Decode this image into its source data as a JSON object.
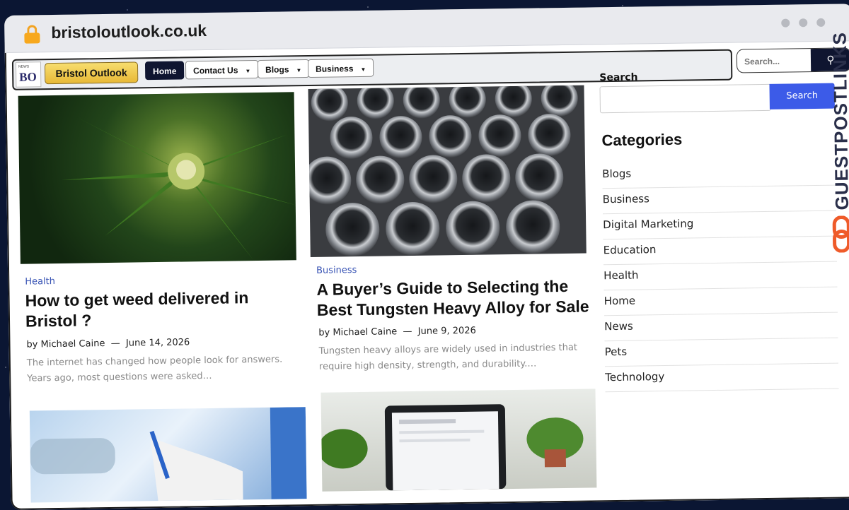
{
  "browser": {
    "url": "bristoloutlook.co.uk"
  },
  "nav": {
    "logo_small": "NEWS",
    "logo_big": "BO",
    "brand": "Bristol Outlook",
    "items": [
      {
        "label": "Home",
        "active": true
      },
      {
        "label": "Contact Us",
        "dropdown": true
      },
      {
        "label": "Blogs",
        "dropdown": true
      },
      {
        "label": "Business",
        "dropdown": true
      }
    ],
    "search_placeholder": "Search..."
  },
  "posts": [
    {
      "category": "Health",
      "title": "How to get weed delivered in Bristol ?",
      "author": "by Michael Caine",
      "date": "June 14, 2026",
      "excerpt": "The internet has changed how people look for answers. Years ago, most questions were asked…"
    },
    {
      "category": "Business",
      "title": "A Buyer’s Guide to Selecting the Best Tungsten Heavy Alloy for Sale",
      "author": "by Michael Caine",
      "date": "June 9, 2026",
      "excerpt": "Tungsten heavy alloys are widely used in industries that require high density, strength, and durability.…"
    }
  ],
  "sidebar": {
    "search_label": "Search",
    "search_button": "Search",
    "categories_title": "Categories",
    "categories": [
      "Blogs",
      "Business",
      "Digital Marketing",
      "Education",
      "Health",
      "Home",
      "News",
      "Pets",
      "Technology"
    ]
  },
  "watermark": {
    "text": "GUESTPOSTLINKS"
  },
  "colors": {
    "accent": "#3c5be8",
    "nav_active": "#0f1530",
    "category": "#3a55b5",
    "brand_gold": "#e8b937"
  }
}
